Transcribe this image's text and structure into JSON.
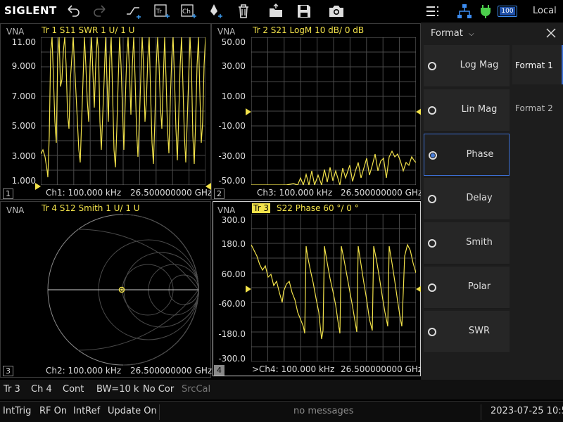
{
  "toolbar": {
    "logo": "SIGLENT",
    "icons": [
      "undo-icon",
      "redo-icon",
      "add-trace-icon",
      "add-trace-tr-icon",
      "add-channel-icon",
      "add-marker-icon",
      "delete-icon",
      "open-folder-icon",
      "save-icon",
      "camera-icon",
      "menu-icon",
      "network-icon",
      "power-plug-icon",
      "battery-icon"
    ],
    "battery_level": "100",
    "local_label": "Local"
  },
  "panels": [
    {
      "number": "1",
      "vna_label": "VNA",
      "trace_title": "Tr 1   S11  SWR  1 U/  1 U",
      "y_ticks": [
        "11.00",
        "9.000",
        "7.000",
        "5.000",
        "3.000",
        "1.000"
      ],
      "footer_start": "Ch1: 100.000 kHz",
      "footer_stop": "26.500000000 GHz"
    },
    {
      "number": "2",
      "vna_label": "VNA",
      "trace_title": "Tr 2   S21  LogM  10 dB/  0 dB",
      "y_ticks": [
        "50.00",
        "30.00",
        "10.00",
        "-10.00",
        "-30.00",
        "-50.00"
      ],
      "footer_start": "Ch3: 100.000 kHz",
      "footer_stop": "26.500000000 GHz"
    },
    {
      "number": "3",
      "vna_label": "VNA",
      "trace_title": "Tr 4   S12  Smith  1 U/  1 U",
      "footer_start": "Ch2: 100.000 kHz",
      "footer_stop": "26.500000000 GHz"
    },
    {
      "number": "4",
      "vna_label": "VNA",
      "trace_tag": "Tr 3",
      "trace_title": "S22  Phase  60 °/  0 °",
      "y_ticks": [
        "300.0",
        "180.0",
        "60.00",
        "-60.00",
        "-180.0",
        "-300.0"
      ],
      "footer_start": ">Ch4: 100.000 kHz",
      "footer_stop": "26.500000000 GHz"
    }
  ],
  "sidebar": {
    "header": "Format",
    "close_icon": "close-icon",
    "items": [
      {
        "label": "Log Mag",
        "selected": false
      },
      {
        "label": "Lin Mag",
        "selected": false
      },
      {
        "label": "Phase",
        "selected": true
      },
      {
        "label": "Delay",
        "selected": false
      },
      {
        "label": "Smith",
        "selected": false
      },
      {
        "label": "Polar",
        "selected": false
      },
      {
        "label": "SWR",
        "selected": false
      }
    ],
    "tabs": [
      {
        "label": "Format 1",
        "active": true
      },
      {
        "label": "Format 2",
        "active": false
      }
    ]
  },
  "status_bar": {
    "trace": "Tr 3",
    "channel": "Ch 4",
    "sweep_mode": "Cont",
    "bandwidth": "BW=10 k",
    "correction": "No Cor",
    "src_cal": "SrcCal"
  },
  "bottom_bar": {
    "trigger": "IntTrig",
    "rf": "RF On",
    "reference": "IntRef",
    "update": "Update On",
    "messages": "no messages",
    "datetime": "2023-07-25 10:55"
  },
  "colors": {
    "trace": "#f2e24a",
    "accent": "#3c6ed0",
    "background": "#000000",
    "sidebar": "#1d1d1d"
  }
}
